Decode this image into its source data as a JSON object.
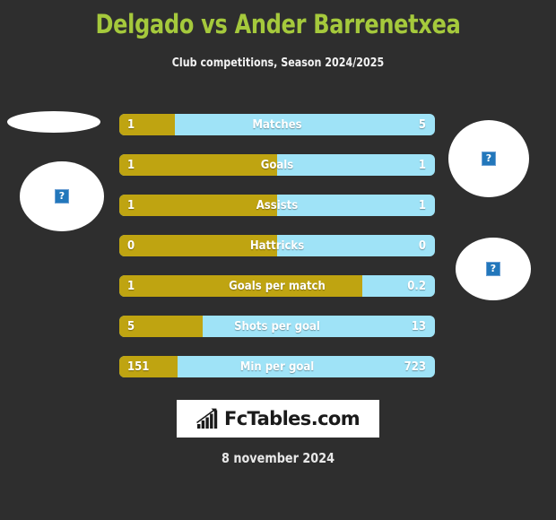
{
  "header": {
    "title": "Delgado vs Ander Barrenetxea",
    "subtitle": "Club competitions, Season 2024/2025",
    "title_color": "#a5c93c"
  },
  "theme": {
    "background": "#2e2e2e",
    "player_left_color": "#bfa411",
    "player_right_color": "#9fe3f7",
    "text_color": "#ffffff"
  },
  "placeholders": [
    {
      "name": "player-left-top-image",
      "alt": "?"
    },
    {
      "name": "player-left-bottom-image",
      "alt": "?"
    },
    {
      "name": "player-right-top-image",
      "alt": "?"
    },
    {
      "name": "player-right-bottom-image",
      "alt": "?"
    }
  ],
  "footer": {
    "logo_text": "FcTables.com",
    "logo_icon": "bar-chart-growth-icon",
    "date": "8 november 2024"
  },
  "chart_data": {
    "type": "bar",
    "title": "Delgado vs Ander Barrenetxea",
    "subtitle": "Club competitions, Season 2024/2025",
    "orientation": "horizontal-diverging",
    "series": [
      {
        "name": "Delgado",
        "color": "#bfa411",
        "side": "left"
      },
      {
        "name": "Ander Barrenetxea",
        "color": "#9fe3f7",
        "side": "right"
      }
    ],
    "categories": [
      "Matches",
      "Goals",
      "Assists",
      "Hattricks",
      "Goals per match",
      "Shots per goal",
      "Min per goal"
    ],
    "rows": [
      {
        "label": "Matches",
        "left": "1",
        "right": "5",
        "left_pct": 17.5
      },
      {
        "label": "Goals",
        "left": "1",
        "right": "1",
        "left_pct": 50.0
      },
      {
        "label": "Assists",
        "left": "1",
        "right": "1",
        "left_pct": 50.0
      },
      {
        "label": "Hattricks",
        "left": "0",
        "right": "0",
        "left_pct": 50.0
      },
      {
        "label": "Goals per match",
        "left": "1",
        "right": "0.2",
        "left_pct": 77.0
      },
      {
        "label": "Shots per goal",
        "left": "5",
        "right": "13",
        "left_pct": 26.5
      },
      {
        "label": "Min per goal",
        "left": "151",
        "right": "723",
        "left_pct": 18.5
      }
    ]
  }
}
